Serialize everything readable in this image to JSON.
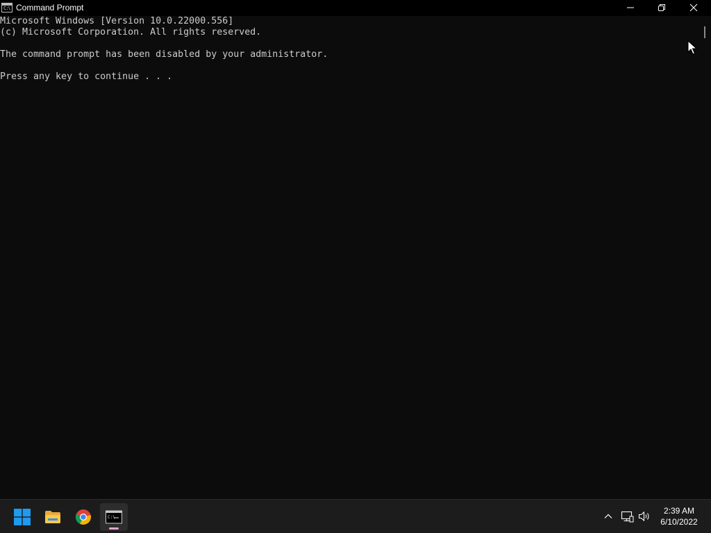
{
  "window": {
    "title": "Command Prompt",
    "icon": "cmd-icon"
  },
  "console": {
    "lines": [
      "Microsoft Windows [Version 10.0.22000.556]",
      "(c) Microsoft Corporation. All rights reserved.",
      "",
      "The command prompt has been disabled by your administrator.",
      "",
      "Press any key to continue . . ."
    ]
  },
  "taskbar": {
    "apps": [
      {
        "name": "start",
        "icon": "windows-logo-icon"
      },
      {
        "name": "file-explorer",
        "icon": "folder-icon"
      },
      {
        "name": "chrome",
        "icon": "chrome-icon"
      },
      {
        "name": "command-prompt",
        "icon": "cmd-icon",
        "active": true
      }
    ],
    "tray": {
      "icons": [
        "chevron-up-icon",
        "network-icon",
        "volume-icon"
      ],
      "time": "2:39 AM",
      "date": "6/10/2022"
    }
  },
  "colors": {
    "console_bg": "#0c0c0c",
    "console_text": "#cccccc",
    "titlebar_bg": "#000000",
    "taskbar_bg": "#1c1c1c",
    "active_indicator": "#e3a7c9"
  }
}
